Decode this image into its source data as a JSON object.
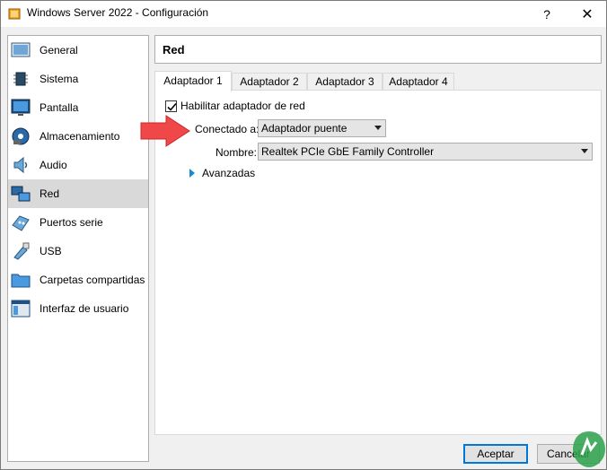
{
  "window": {
    "title": "Windows Server 2022 - Configuración",
    "help": "?",
    "close": "✕"
  },
  "sidebar": {
    "items": [
      {
        "label": "General",
        "icon": "general-icon"
      },
      {
        "label": "Sistema",
        "icon": "chip-icon"
      },
      {
        "label": "Pantalla",
        "icon": "monitor-icon"
      },
      {
        "label": "Almacenamiento",
        "icon": "disk-icon"
      },
      {
        "label": "Audio",
        "icon": "speaker-icon"
      },
      {
        "label": "Red",
        "icon": "network-icon",
        "selected": true
      },
      {
        "label": "Puertos serie",
        "icon": "serial-port-icon"
      },
      {
        "label": "USB",
        "icon": "usb-icon"
      },
      {
        "label": "Carpetas compartidas",
        "icon": "folder-icon"
      },
      {
        "label": "Interfaz de usuario",
        "icon": "ui-icon"
      }
    ]
  },
  "header": {
    "title": "Red"
  },
  "tabs": [
    "Adaptador 1",
    "Adaptador 2",
    "Adaptador 3",
    "Adaptador 4"
  ],
  "adapter": {
    "enable_label": "Habilitar adaptador de red",
    "enabled": true,
    "attached_label": "Conectado a:",
    "attached_value": "Adaptador puente",
    "name_label": "Nombre:",
    "name_value": "Realtek PCIe GbE Family Controller",
    "advanced_label": "Avanzadas"
  },
  "buttons": {
    "ok": "Aceptar",
    "cancel": "Cancelar"
  },
  "colors": {
    "accent": "#0078d7",
    "arrow": "#f04848",
    "selected_bg": "#d9d9d9"
  }
}
